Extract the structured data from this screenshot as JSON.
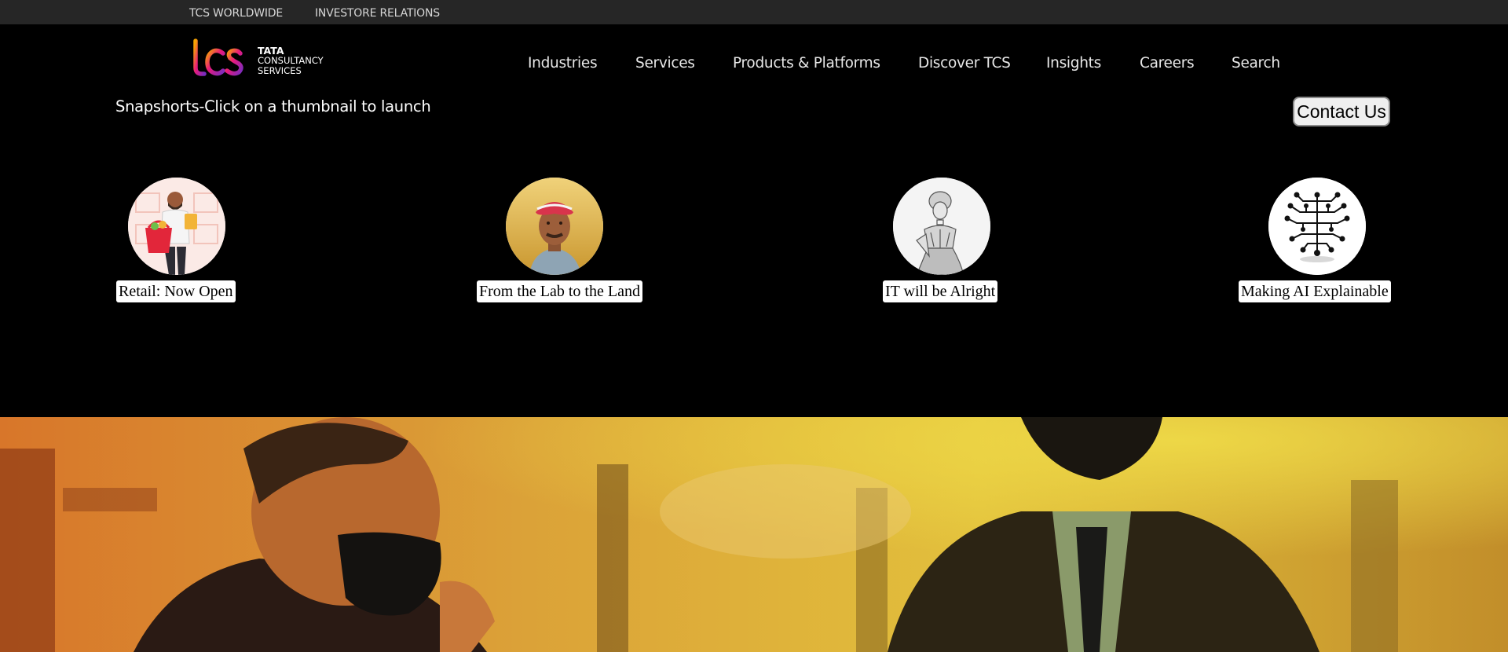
{
  "topbar": {
    "links": [
      "TCS WORLDWIDE",
      "INVESTORE RELATIONS"
    ]
  },
  "logo": {
    "mark": "tcs",
    "line1": "TATA",
    "line2": "CONSULTANCY",
    "line3": "SERVICES"
  },
  "nav": {
    "items": [
      "Industries",
      "Services",
      "Products & Platforms",
      "Discover TCS",
      "Insights",
      "Careers",
      "Search"
    ]
  },
  "snapshorts": {
    "title": "Snapshorts-Click on a thumbnail to launch",
    "items": [
      {
        "caption": "Retail: Now Open",
        "icon": "retail-shopper-illustration"
      },
      {
        "caption": "From the Lab to the Land",
        "icon": "farmer-portrait"
      },
      {
        "caption": "IT will be Alright",
        "icon": "victorian-woman-engraving"
      },
      {
        "caption": "Making AI Explainable",
        "icon": "circuit-brain-icon"
      }
    ]
  },
  "contact": {
    "label": "Contact Us"
  },
  "hero": {
    "image": "masked-businessmen-meeting-photo"
  },
  "colors": {
    "topbar_bg": "#262626",
    "header_bg": "#000000",
    "hero_tint": "#e0a51c"
  }
}
